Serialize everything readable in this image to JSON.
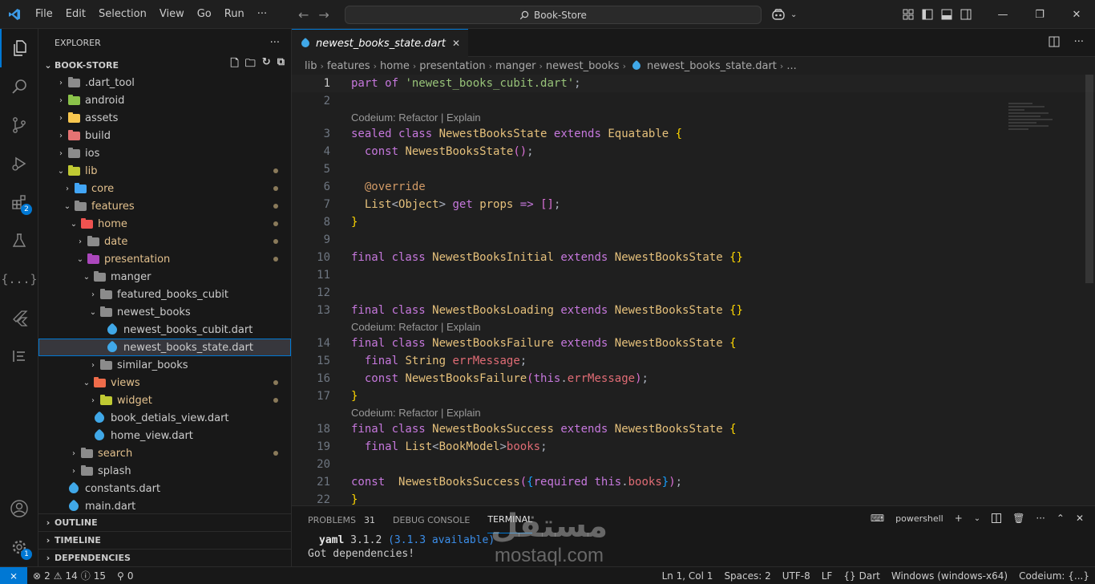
{
  "menu": [
    "File",
    "Edit",
    "Selection",
    "View",
    "Go",
    "Run",
    "···"
  ],
  "search": {
    "text": "Book-Store"
  },
  "sidebar": {
    "title": "EXPLORER",
    "more": "···",
    "project": "BOOK-STORE",
    "tree": [
      {
        "label": ".dart_tool",
        "depth": 0,
        "type": "folder",
        "expanded": false,
        "color": "#8b8b8b"
      },
      {
        "label": "android",
        "depth": 0,
        "type": "folder",
        "expanded": false,
        "color": "#8bc34a"
      },
      {
        "label": "assets",
        "depth": 0,
        "type": "folder",
        "expanded": false,
        "color": "#f9c74f"
      },
      {
        "label": "build",
        "depth": 0,
        "type": "folder",
        "expanded": false,
        "color": "#e57373"
      },
      {
        "label": "ios",
        "depth": 0,
        "type": "folder",
        "expanded": false,
        "color": "#8b8b8b"
      },
      {
        "label": "lib",
        "depth": 0,
        "type": "folder",
        "expanded": true,
        "color": "#c0ca33",
        "modified": true
      },
      {
        "label": "core",
        "depth": 1,
        "type": "folder",
        "expanded": false,
        "color": "#42a5f5",
        "modified": true
      },
      {
        "label": "features",
        "depth": 1,
        "type": "folder",
        "expanded": true,
        "color": "#8b8b8b",
        "modified": true
      },
      {
        "label": "home",
        "depth": 2,
        "type": "folder",
        "expanded": true,
        "color": "#ef5350",
        "modified": true
      },
      {
        "label": "date",
        "depth": 3,
        "type": "folder",
        "expanded": false,
        "color": "#8b8b8b",
        "modified": true
      },
      {
        "label": "presentation",
        "depth": 3,
        "type": "folder",
        "expanded": true,
        "color": "#ab47bc",
        "modified": true
      },
      {
        "label": "manger",
        "depth": 4,
        "type": "folder",
        "expanded": true,
        "color": "#8b8b8b"
      },
      {
        "label": "featured_books_cubit",
        "depth": 5,
        "type": "folder",
        "expanded": false,
        "color": "#8b8b8b"
      },
      {
        "label": "newest_books",
        "depth": 5,
        "type": "folder",
        "expanded": true,
        "color": "#8b8b8b"
      },
      {
        "label": "newest_books_cubit.dart",
        "depth": 6,
        "type": "dart"
      },
      {
        "label": "newest_books_state.dart",
        "depth": 6,
        "type": "dart",
        "selected": true
      },
      {
        "label": "similar_books",
        "depth": 5,
        "type": "folder",
        "expanded": false,
        "color": "#8b8b8b"
      },
      {
        "label": "views",
        "depth": 4,
        "type": "folder",
        "expanded": true,
        "color": "#ef6c4a",
        "modified": true
      },
      {
        "label": "widget",
        "depth": 5,
        "type": "folder",
        "expanded": false,
        "color": "#c0ca33",
        "modified": true
      },
      {
        "label": "book_detials_view.dart",
        "depth": 5,
        "type": "dart",
        "nochev": true
      },
      {
        "label": "home_view.dart",
        "depth": 5,
        "type": "dart",
        "nochev": true
      },
      {
        "label": "search",
        "depth": 2,
        "type": "folder",
        "expanded": false,
        "color": "#8b8b8b",
        "modified": true
      },
      {
        "label": "splash",
        "depth": 2,
        "type": "folder",
        "expanded": false,
        "color": "#8b8b8b"
      },
      {
        "label": "constants.dart",
        "depth": 1,
        "type": "dart",
        "nochev": true
      },
      {
        "label": "main.dart",
        "depth": 1,
        "type": "dart",
        "nochev": true
      }
    ],
    "sections": [
      "OUTLINE",
      "TIMELINE",
      "DEPENDENCIES"
    ]
  },
  "activity": {
    "extensions_badge": "2",
    "accounts_badge": "1"
  },
  "editor": {
    "tab": "newest_books_state.dart",
    "breadcrumbs": [
      "lib",
      "features",
      "home",
      "presentation",
      "manger",
      "newest_books",
      "newest_books_state.dart",
      "..."
    ],
    "codelens": "Codeium: Refactor | Explain"
  },
  "panel": {
    "tabs": [
      "PROBLEMS",
      "DEBUG CONSOLE",
      "TERMINAL"
    ],
    "problems_count": "31",
    "shell": "powershell",
    "terminal_line1_pkg": "yaml",
    "terminal_line1_ver": " 3.1.2 ",
    "terminal_line1_avail": "(3.1.3 available)",
    "terminal_line2": "Got dependencies!"
  },
  "watermark": {
    "arabic": "مستقل",
    "latin": "mostaql.com"
  },
  "status": {
    "errors": "2",
    "warnings": "14",
    "info": "15",
    "ports": "0",
    "position": "Ln 1, Col 1",
    "spaces": "Spaces: 2",
    "encoding": "UTF-8",
    "eol": "LF",
    "language": "Dart",
    "platform": "Windows (windows-x64)",
    "codeium": "Codeium: {...}"
  }
}
